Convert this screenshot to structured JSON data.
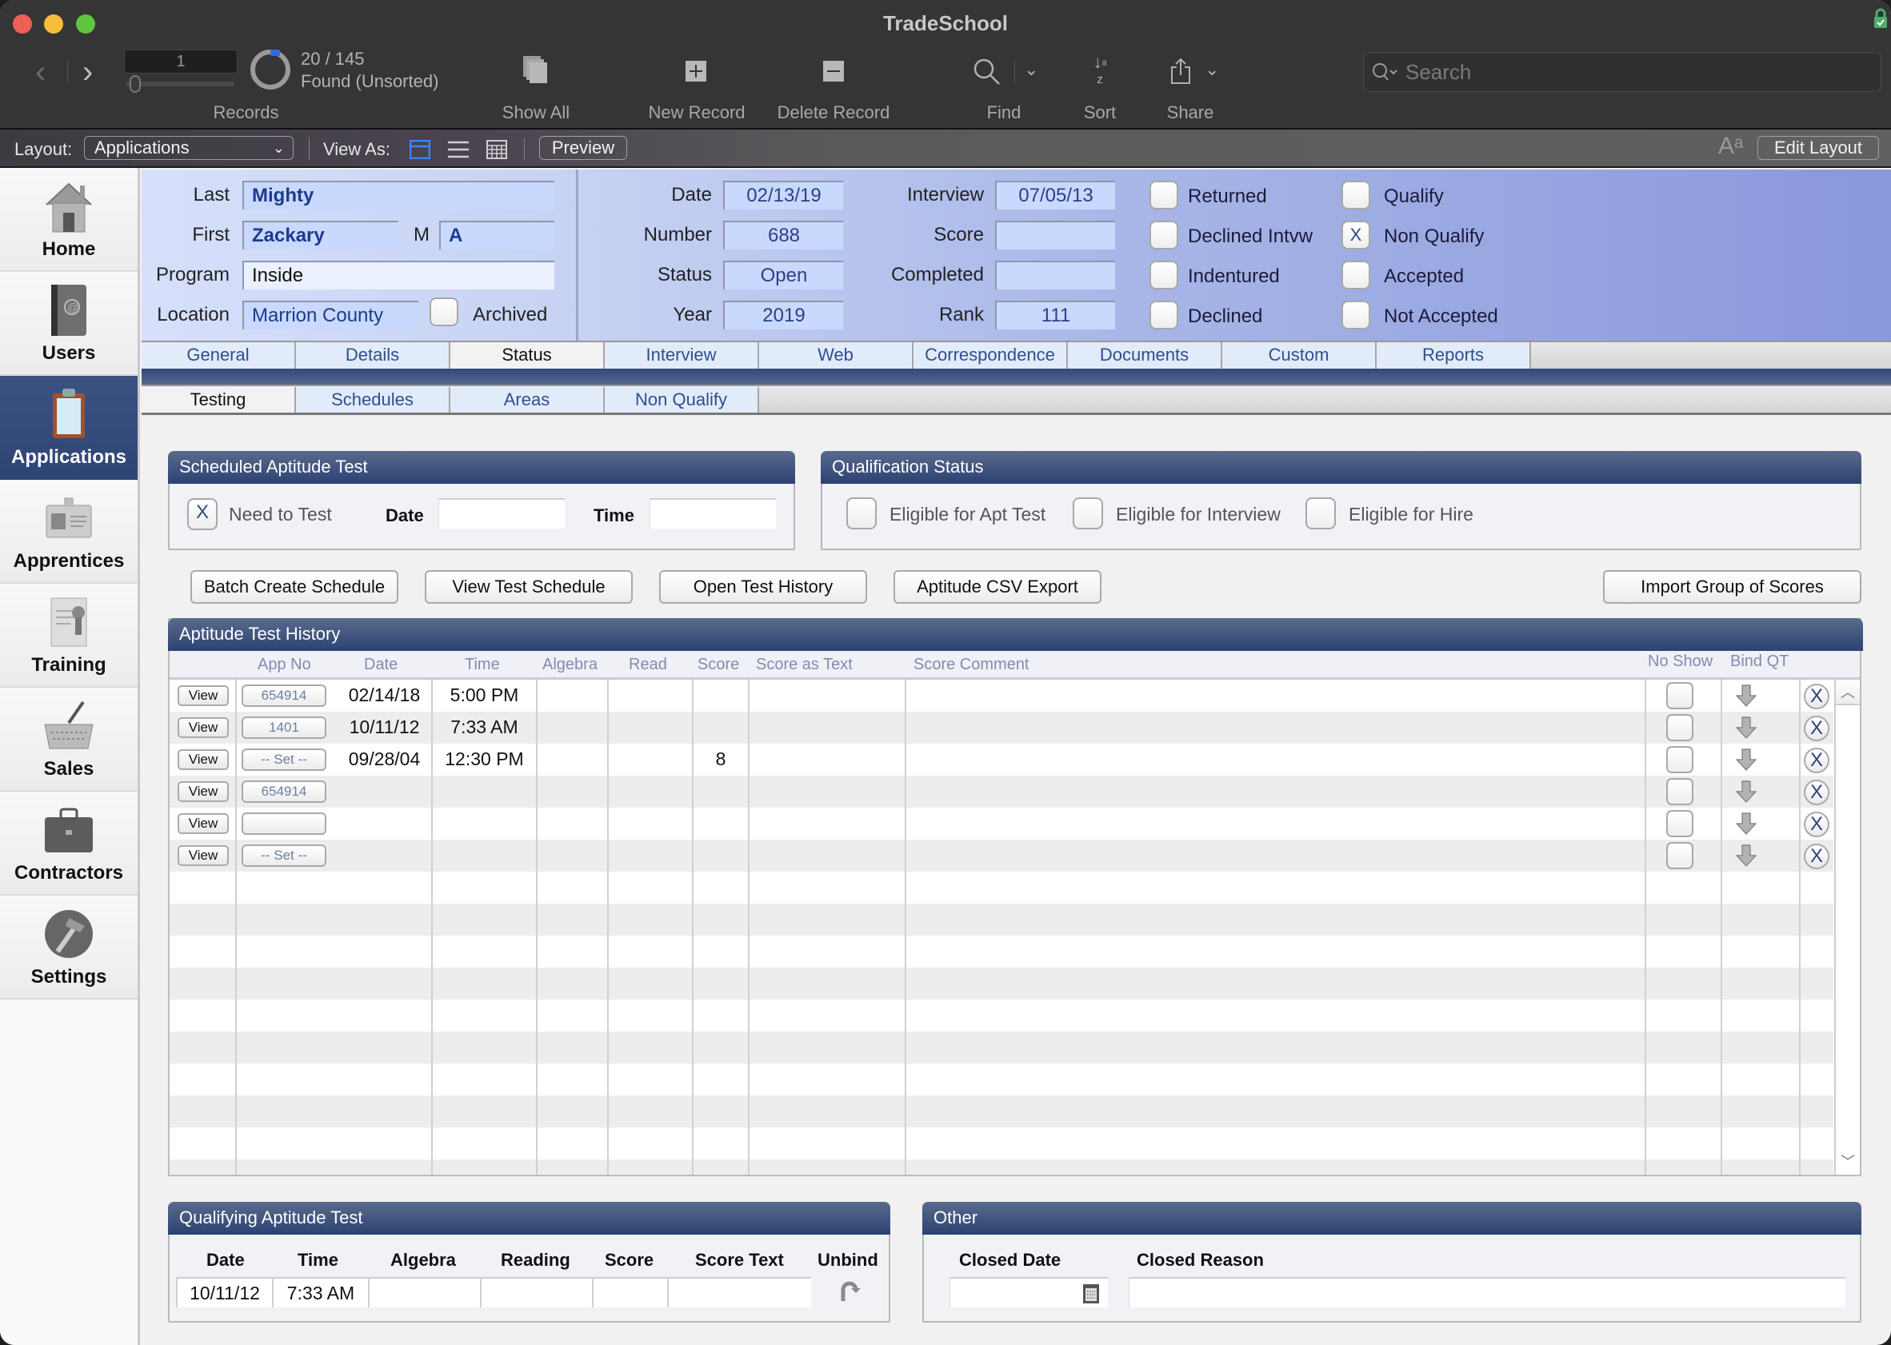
{
  "window": {
    "title": "TradeSchool"
  },
  "toolbar": {
    "record_number": "1",
    "found_count": "20 / 145",
    "found_status": "Found (Unsorted)",
    "records_label": "Records",
    "show_all_label": "Show All",
    "new_record_label": "New Record",
    "delete_record_label": "Delete Record",
    "find_label": "Find",
    "sort_label": "Sort",
    "share_label": "Share",
    "search_placeholder": "Search",
    "found_fraction": 0.138
  },
  "layout_bar": {
    "layout_label": "Layout:",
    "layout_value": "Applications",
    "view_as_label": "View As:",
    "preview_label": "Preview",
    "edit_layout_label": "Edit Layout",
    "font_size_glyph": "Aᵃ"
  },
  "sidebar": {
    "items": [
      {
        "label": "Home",
        "icon": "house-icon",
        "active": false
      },
      {
        "label": "Users",
        "icon": "address-book-icon",
        "active": false
      },
      {
        "label": "Applications",
        "icon": "clipboard-icon",
        "active": true
      },
      {
        "label": "Apprentices",
        "icon": "id-badge-icon",
        "active": false
      },
      {
        "label": "Training",
        "icon": "certificate-icon",
        "active": false
      },
      {
        "label": "Sales",
        "icon": "basket-icon",
        "active": false
      },
      {
        "label": "Contractors",
        "icon": "briefcase-icon",
        "active": false
      },
      {
        "label": "Settings",
        "icon": "hammer-icon",
        "active": false
      }
    ]
  },
  "record": {
    "last_label": "Last",
    "last": "Mighty",
    "first_label": "First",
    "first": "Zackary",
    "middle_label": "M",
    "middle": "A",
    "program_label": "Program",
    "program": "Inside",
    "location_label": "Location",
    "location": "Marrion County",
    "archived_label": "Archived",
    "archived": "",
    "date_label": "Date",
    "date": "02/13/19",
    "number_label": "Number",
    "number": "688",
    "status_label": "Status",
    "status": "Open",
    "year_label": "Year",
    "year": "2019",
    "interview_label": "Interview",
    "interview": "07/05/13",
    "score_label": "Score",
    "score": "",
    "completed_label": "Completed",
    "completed": "",
    "rank_label": "Rank",
    "rank": "111",
    "flags": [
      {
        "label": "Returned",
        "mark": ""
      },
      {
        "label": "Declined Intvw",
        "mark": ""
      },
      {
        "label": "Indentured",
        "mark": ""
      },
      {
        "label": "Declined",
        "mark": ""
      },
      {
        "label": "Qualify",
        "mark": ""
      },
      {
        "label": "Non Qualify",
        "mark": "X"
      },
      {
        "label": "Accepted",
        "mark": ""
      },
      {
        "label": "Not Accepted",
        "mark": ""
      }
    ]
  },
  "tabs": [
    "General",
    "Details",
    "Status",
    "Interview",
    "Web",
    "Correspondence",
    "Documents",
    "Custom",
    "Reports"
  ],
  "active_tab": "Status",
  "subtabs": [
    "Testing",
    "Schedules",
    "Areas",
    "Non Qualify"
  ],
  "active_subtab": "Testing",
  "scheduled": {
    "title": "Scheduled Aptitude Test",
    "need_to_test_mark": "X",
    "need_to_test_label": "Need to Test",
    "date_label": "Date",
    "date": "",
    "time_label": "Time",
    "time": ""
  },
  "qualification": {
    "title": "Qualification Status",
    "items": [
      {
        "label": "Eligible for Apt Test",
        "mark": ""
      },
      {
        "label": "Eligible for Interview",
        "mark": ""
      },
      {
        "label": "Eligible for Hire",
        "mark": ""
      }
    ]
  },
  "actions": {
    "batch_create": "Batch Create Schedule",
    "view_schedule": "View Test Schedule",
    "open_history": "Open Test History",
    "csv_export": "Aptitude CSV Export",
    "import_scores": "Import Group of Scores"
  },
  "history": {
    "title": "Aptitude Test History",
    "columns": [
      "App No",
      "Date",
      "Time",
      "Algebra",
      "Read",
      "Score",
      "Score as Text",
      "Score Comment",
      "No Show",
      "Bind QT"
    ],
    "view_label": "View",
    "rows": [
      {
        "app_no": "654914",
        "date": "02/14/18",
        "time": "5:00 PM",
        "algebra": "",
        "read": "",
        "score": "",
        "score_text": "",
        "comment": ""
      },
      {
        "app_no": "1401",
        "date": "10/11/12",
        "time": "7:33 AM",
        "algebra": "",
        "read": "",
        "score": "",
        "score_text": "",
        "comment": ""
      },
      {
        "app_no": "-- Set --",
        "date": "09/28/04",
        "time": "12:30 PM",
        "algebra": "",
        "read": "",
        "score": "8",
        "score_text": "",
        "comment": ""
      },
      {
        "app_no": "654914",
        "date": "",
        "time": "",
        "algebra": "",
        "read": "",
        "score": "",
        "score_text": "",
        "comment": ""
      },
      {
        "app_no": "",
        "date": "",
        "time": "",
        "algebra": "",
        "read": "",
        "score": "",
        "score_text": "",
        "comment": ""
      },
      {
        "app_no": "-- Set --",
        "date": "",
        "time": "",
        "algebra": "",
        "read": "",
        "score": "",
        "score_text": "",
        "comment": ""
      }
    ],
    "delete_glyph": "X"
  },
  "qualifying": {
    "title": "Qualifying Aptitude Test",
    "columns": [
      "Date",
      "Time",
      "Algebra",
      "Reading",
      "Score",
      "Score Text",
      "Unbind"
    ],
    "values": [
      "10/11/12",
      "7:33 AM",
      "",
      "",
      "",
      ""
    ]
  },
  "other": {
    "title": "Other",
    "closed_date_label": "Closed Date",
    "closed_date": "",
    "closed_reason_label": "Closed Reason",
    "closed_reason": ""
  }
}
